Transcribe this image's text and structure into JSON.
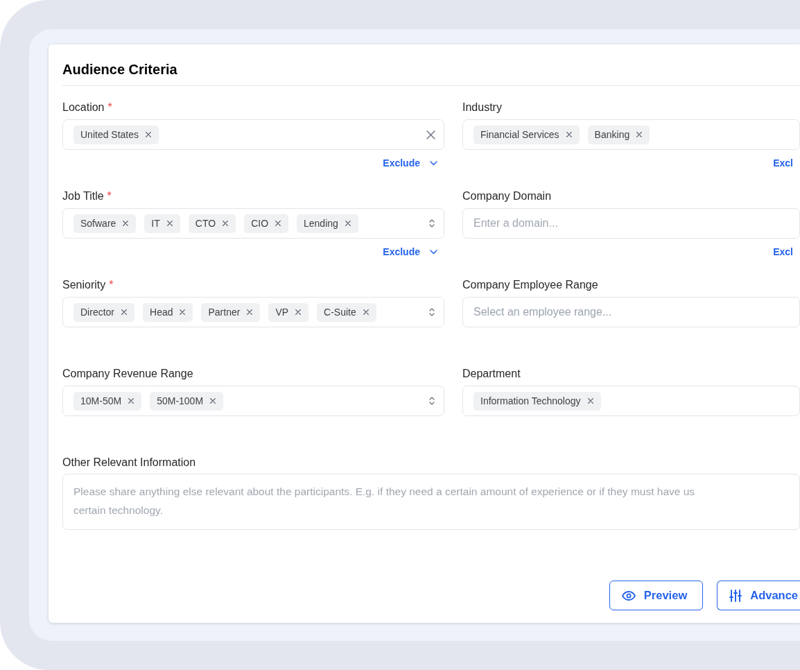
{
  "card": {
    "title": "Audience Criteria"
  },
  "fields": [
    {
      "label": "Location",
      "required_mark": "*",
      "kind": "tags",
      "tags": [
        "United States"
      ],
      "clearable": true,
      "dropdown": false,
      "exclude": {
        "label": "Exclude",
        "chevron": true
      }
    },
    {
      "label": "Industry",
      "kind": "tags",
      "tags": [
        "Financial Services",
        "Banking"
      ],
      "clearable": false,
      "dropdown": false,
      "exclude": {
        "label": "Excl",
        "chevron": false
      }
    },
    {
      "label": "Job Title",
      "required_mark": "*",
      "kind": "tags",
      "tags": [
        "Sofware",
        "IT",
        "CTO",
        "CIO",
        "Lending"
      ],
      "clearable": false,
      "dropdown": true,
      "exclude": {
        "label": "Exclude",
        "chevron": true
      }
    },
    {
      "label": "Company Domain",
      "kind": "text",
      "placeholder": "Enter a domain...",
      "clearable": false,
      "dropdown": false,
      "exclude": {
        "label": "Excl",
        "chevron": false
      }
    },
    {
      "label": "Seniority",
      "required_mark": "*",
      "kind": "tags",
      "tags": [
        "Director",
        "Head",
        "Partner",
        "VP",
        "C-Suite"
      ],
      "clearable": false,
      "dropdown": true
    },
    {
      "label": "Company Employee Range",
      "kind": "select",
      "placeholder": "Select an employee range...",
      "clearable": false,
      "dropdown": false
    },
    {
      "label": "Company Revenue Range",
      "kind": "tags",
      "tags": [
        "10M-50M",
        "50M-100M"
      ],
      "clearable": false,
      "dropdown": true
    },
    {
      "label": "Department",
      "kind": "tags",
      "tags": [
        "Information Technology"
      ],
      "clearable": false,
      "dropdown": false
    }
  ],
  "other": {
    "label": "Other Relevant Information",
    "placeholder": "Please share anything else relevant about the participants. E.g. if they need a certain amount of experience or if they must have us\ncertain technology."
  },
  "buttons": [
    {
      "label": "Preview"
    },
    {
      "label": "Advance"
    }
  ]
}
